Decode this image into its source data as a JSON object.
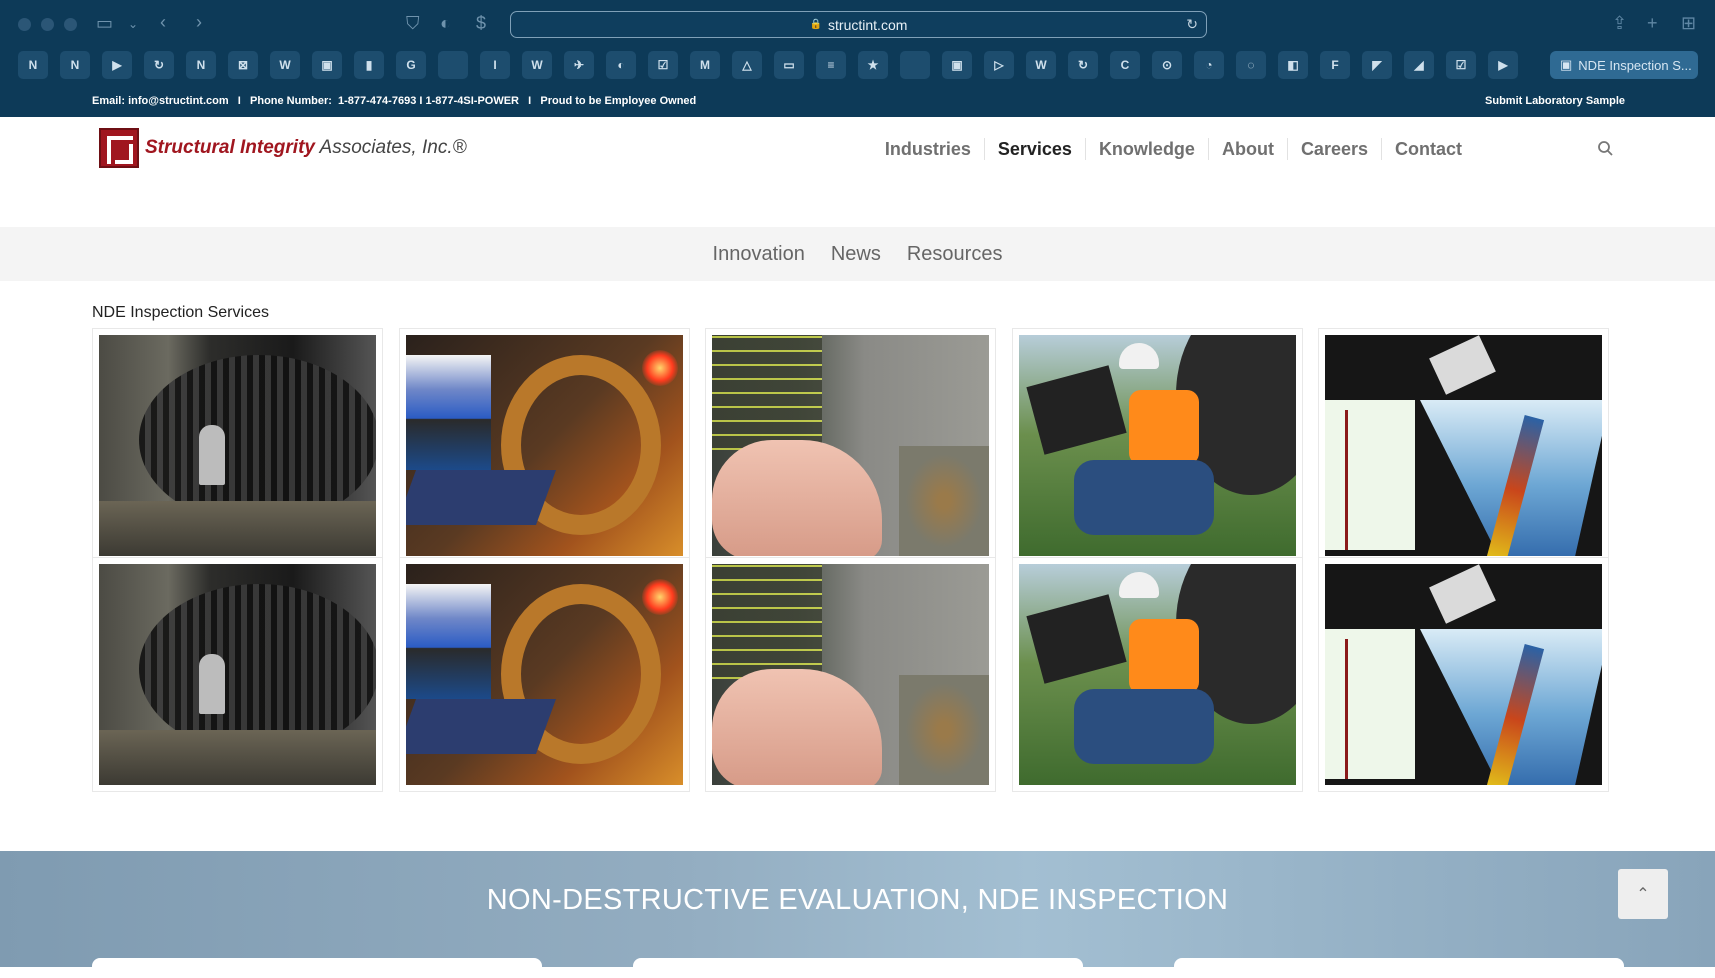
{
  "browser": {
    "url": "structint.com",
    "bookmark_icons": [
      "N",
      "N",
      "▶",
      "↻",
      "N",
      "⊠",
      "W",
      "▣",
      "▮",
      "G",
      "",
      "I",
      "W",
      "✈",
      "◐",
      "☑",
      "M",
      "△",
      "▭",
      "≡",
      "★",
      "",
      "▣",
      "▷",
      "W",
      "↻",
      "C",
      "⊙",
      "◔",
      "◌",
      "◧",
      "F",
      "◤",
      "◢",
      "☑",
      "▶"
    ],
    "active_tab_label": "NDE Inspection S..."
  },
  "infobar": {
    "left_text": "Email: info@structint.com   I   Phone Number:  1-877-474-7693 I 1-877-4SI-POWER   I   Proud to be Employee Owned",
    "right_text": "Submit Laboratory Sample"
  },
  "logo": {
    "name_red": "Structural Integrity",
    "name_grey": " Associates, Inc.®"
  },
  "main_nav": [
    {
      "label": "Industries",
      "active": false
    },
    {
      "label": "Services",
      "active": true
    },
    {
      "label": "Knowledge",
      "active": false
    },
    {
      "label": "About",
      "active": false
    },
    {
      "label": "Careers",
      "active": false
    },
    {
      "label": "Contact",
      "active": false
    }
  ],
  "sub_nav": [
    "Innovation",
    "News",
    "Resources"
  ],
  "gallery": {
    "title": "NDE Inspection Services",
    "rows": [
      [
        "turbine",
        "laptop",
        "probe",
        "inspector",
        "scan"
      ],
      [
        "turbine",
        "laptop",
        "probe",
        "inspector",
        "scan"
      ]
    ]
  },
  "banner": {
    "heading": "NON-DESTRUCTIVE EVALUATION, NDE INSPECTION"
  },
  "colors": {
    "chrome": "#0d3a58",
    "brand_red": "#a0161f",
    "nav_active": "#222222",
    "nav_inactive": "#707070"
  }
}
